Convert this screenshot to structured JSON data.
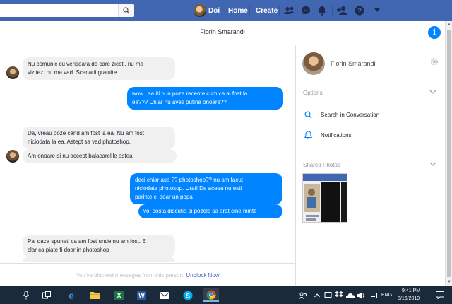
{
  "topbar": {
    "user_name": "Doi",
    "home_label": "Home",
    "create_label": "Create",
    "colors": {
      "brand": "#4267b2"
    },
    "icons": [
      "search-icon",
      "friends-icon",
      "messenger-icon",
      "notifications-icon",
      "find-friends-icon",
      "help-icon",
      "caret-down-icon"
    ]
  },
  "conversation": {
    "title": "Florin Smarandi",
    "messages": [
      {
        "direction": "in",
        "lines": [
          "Nu comunic cu verisoara de care ziceti, nu ma",
          "vizitez, nu ma vad. Scenarii gratuite...."
        ]
      },
      {
        "direction": "out",
        "lines": [
          "wow ..sa iti pun poze recente cum ca ai fost la",
          "ea??? Chiar nu aveti putina onoare??"
        ]
      },
      {
        "direction": "in",
        "lines": [
          "Da, vreau poze cand am fost la ea. Nu am fost",
          "niciodata la ea. Astept sa vad photoshop."
        ]
      },
      {
        "direction": "in",
        "lines": [
          "Am onoare si nu accept balacarelile astea."
        ]
      },
      {
        "direction": "out",
        "lines": [
          "deci chiar asa ?? photoshop?? nu am facut",
          "niciodata photosop. Urat! De aceea nu esti",
          "parinte ci  doar un popa"
        ]
      },
      {
        "direction": "out",
        "lines": [
          "voi posta discutia si pozele sa arat cine minte"
        ]
      },
      {
        "direction": "in",
        "lines": [
          "Pai daca spuneti ca am fost unde nu am fost. E",
          "clar ca piate fi doar in photoshop"
        ]
      }
    ],
    "blocked_text": "You've blocked messages from this person.",
    "unblock_label": "Unblock Now"
  },
  "right_panel": {
    "name": "Florin Smarandi",
    "options_label": "Options",
    "search_label": "Search in Conversation",
    "notifications_label": "Notifications",
    "shared_photos_label": "Shared Photos",
    "accent": "#0084ff"
  },
  "taskbar": {
    "apps": [
      "microphone-icon",
      "task-view-icon",
      "edge-icon",
      "file-explorer-icon",
      "excel-icon",
      "word-icon",
      "mail-icon",
      "skype-icon",
      "chrome-icon"
    ],
    "language": "ENG",
    "time": "9:41 PM",
    "date": "8/16/2019"
  }
}
